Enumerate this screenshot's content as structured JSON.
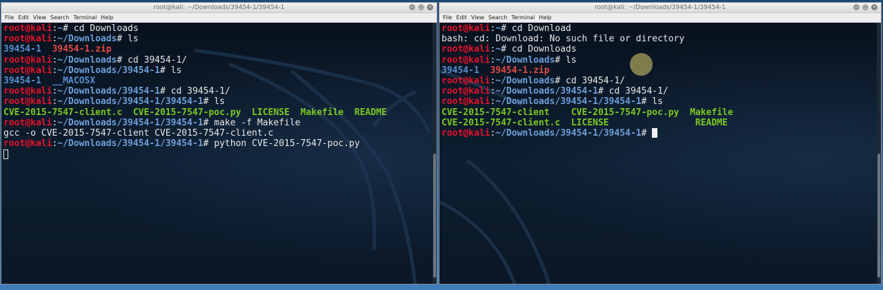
{
  "colors": {
    "user": "#e8102b",
    "path": "#6f9fd8",
    "executable": "#7cc823",
    "directory": "#5a8ed0",
    "archive": "#e34a46"
  },
  "menu": [
    "File",
    "Edit",
    "View",
    "Search",
    "Terminal",
    "Help"
  ],
  "window_icons": [
    "minimize-icon",
    "maximize-icon",
    "close-icon"
  ],
  "left": {
    "title": "root@kali: ~/Downloads/39454-1/39454-1",
    "lines": [
      [
        {
          "t": "root@kali",
          "c": "u"
        },
        {
          "t": ":"
        },
        {
          "t": "~",
          "c": "p"
        },
        {
          "t": "# cd Downloads"
        }
      ],
      [
        {
          "t": "root@kali",
          "c": "u"
        },
        {
          "t": ":"
        },
        {
          "t": "~/Downloads",
          "c": "p"
        },
        {
          "t": "# ls"
        }
      ],
      [
        {
          "t": "39454-1",
          "c": "bl"
        },
        {
          "t": "  "
        },
        {
          "t": "39454-1.zip",
          "c": "rd"
        }
      ],
      [
        {
          "t": "root@kali",
          "c": "u"
        },
        {
          "t": ":"
        },
        {
          "t": "~/Downloads",
          "c": "p"
        },
        {
          "t": "# cd 39454-1/"
        }
      ],
      [
        {
          "t": "root@kali",
          "c": "u"
        },
        {
          "t": ":"
        },
        {
          "t": "~/Downloads/39454-1",
          "c": "p"
        },
        {
          "t": "# ls"
        }
      ],
      [
        {
          "t": "39454-1",
          "c": "bl"
        },
        {
          "t": "  "
        },
        {
          "t": "__MACOSX",
          "c": "bl"
        }
      ],
      [
        {
          "t": "root@kali",
          "c": "u"
        },
        {
          "t": ":"
        },
        {
          "t": "~/Downloads/39454-1",
          "c": "p"
        },
        {
          "t": "# cd 39454-1/"
        }
      ],
      [
        {
          "t": "root@kali",
          "c": "u"
        },
        {
          "t": ":"
        },
        {
          "t": "~/Downloads/39454-1/39454-1",
          "c": "p"
        },
        {
          "t": "# ls"
        }
      ],
      [
        {
          "t": "CVE-2015-7547-client.c",
          "c": "g"
        },
        {
          "t": "  "
        },
        {
          "t": "CVE-2015-7547-poc.py",
          "c": "g"
        },
        {
          "t": "  "
        },
        {
          "t": "LICENSE",
          "c": "g"
        },
        {
          "t": "  "
        },
        {
          "t": "Makefile",
          "c": "g"
        },
        {
          "t": "  "
        },
        {
          "t": "README",
          "c": "g"
        }
      ],
      [
        {
          "t": "root@kali",
          "c": "u"
        },
        {
          "t": ":"
        },
        {
          "t": "~/Downloads/39454-1/39454-1",
          "c": "p"
        },
        {
          "t": "# make -f Makefile"
        }
      ],
      [
        {
          "t": "gcc -o CVE-2015-7547-client CVE-2015-7547-client.c"
        }
      ],
      [
        {
          "t": "root@kali",
          "c": "u"
        },
        {
          "t": ":"
        },
        {
          "t": "~/Downloads/39454-1/39454-1",
          "c": "p"
        },
        {
          "t": "# python CVE-2015-7547-poc.py"
        }
      ]
    ]
  },
  "right": {
    "title": "root@kali: ~/Downloads/39454-1/39454-1",
    "lines": [
      [
        {
          "t": "root@kali",
          "c": "u"
        },
        {
          "t": ":"
        },
        {
          "t": "~",
          "c": "p"
        },
        {
          "t": "# cd Download"
        }
      ],
      [
        {
          "t": "bash: cd: Download: No such file or directory"
        }
      ],
      [
        {
          "t": "root@kali",
          "c": "u"
        },
        {
          "t": ":"
        },
        {
          "t": "~",
          "c": "p"
        },
        {
          "t": "# cd Downloads"
        }
      ],
      [
        {
          "t": "root@kali",
          "c": "u"
        },
        {
          "t": ":"
        },
        {
          "t": "~/Downloads",
          "c": "p"
        },
        {
          "t": "# ls"
        }
      ],
      [
        {
          "t": "39454-1",
          "c": "bl"
        },
        {
          "t": "  "
        },
        {
          "t": "39454-1.zip",
          "c": "rd"
        }
      ],
      [
        {
          "t": "root@kali",
          "c": "u"
        },
        {
          "t": ":"
        },
        {
          "t": "~/Downloads",
          "c": "p"
        },
        {
          "t": "# cd 39454-1/"
        }
      ],
      [
        {
          "t": "root@kali",
          "c": "u"
        },
        {
          "t": ":"
        },
        {
          "t": "~/Downloads/39454-1",
          "c": "p"
        },
        {
          "t": "# cd 39454-1/"
        }
      ],
      [
        {
          "t": "root@kali",
          "c": "u"
        },
        {
          "t": ":"
        },
        {
          "t": "~/Downloads/39454-1/39454-1",
          "c": "p"
        },
        {
          "t": "# ls"
        }
      ],
      [
        {
          "t": "CVE-2015-7547-client",
          "c": "g"
        },
        {
          "t": "    "
        },
        {
          "t": "CVE-2015-7547-poc.py",
          "c": "g"
        },
        {
          "t": "  "
        },
        {
          "t": "Makefile",
          "c": "g"
        }
      ],
      [
        {
          "t": "CVE-2015-7547-client.c",
          "c": "g"
        },
        {
          "t": "  "
        },
        {
          "t": "LICENSE",
          "c": "g"
        },
        {
          "t": "                "
        },
        {
          "t": "README",
          "c": "g"
        }
      ],
      [
        {
          "t": "root@kali",
          "c": "u"
        },
        {
          "t": ":"
        },
        {
          "t": "~/Downloads/39454-1/39454-1",
          "c": "p"
        },
        {
          "t": "# "
        }
      ]
    ]
  }
}
